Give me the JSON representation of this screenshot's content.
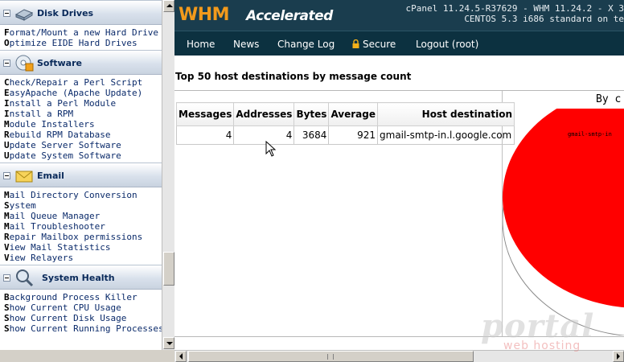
{
  "sidebar": {
    "sections": [
      {
        "title": "Disk Drives",
        "icon": "disk-drive-icon",
        "items": [
          "Format/Mount a new Hard Drive",
          "Optimize EIDE Hard Drives"
        ]
      },
      {
        "title": "Software",
        "icon": "software-cd-icon",
        "items": [
          "Check/Repair a Perl Script",
          "EasyApache (Apache Update)",
          "Install a Perl Module",
          "Install a RPM",
          "Module Installers",
          "Rebuild RPM Database",
          "Update Server Software",
          "Update System Software"
        ]
      },
      {
        "title": "Email",
        "icon": "email-envelope-icon",
        "items": [
          "Mail Directory Conversion",
          "System",
          "Mail Queue Manager",
          "Mail Troubleshooter",
          "Repair Mailbox permissions",
          "View Mail Statistics",
          "View Relayers"
        ]
      },
      {
        "title": "System Health",
        "icon": "magnifier-icon",
        "items": [
          "Background Process Killer",
          "Show Current CPU Usage",
          "Show Current Disk Usage",
          "Show Current Running Processes"
        ]
      }
    ]
  },
  "header": {
    "logo_main": "WHM",
    "logo_sub": "Accelerated",
    "version_line1": "cPanel 11.24.5-R37629 - WHM 11.24.2 - X 3",
    "version_line2": "CENTOS 5.3 i686 standard on te"
  },
  "nav": {
    "home": "Home",
    "news": "News",
    "changelog": "Change Log",
    "secure": "Secure",
    "logout": "Logout (root)"
  },
  "report": {
    "title": "Top 50 host destinations by message count",
    "columns": [
      "Messages",
      "Addresses",
      "Bytes",
      "Average",
      "Host destination"
    ],
    "rows": [
      [
        "4",
        "4",
        "3684",
        "921",
        "gmail-smtp-in.l.google.com"
      ]
    ]
  },
  "chart_data": {
    "type": "pie",
    "title": "By c",
    "slices": [
      {
        "label": "gmail-smtp-in",
        "value": 100,
        "color": "#ff0000"
      }
    ]
  },
  "watermark": {
    "main": "portal",
    "sub": "web hosting"
  }
}
